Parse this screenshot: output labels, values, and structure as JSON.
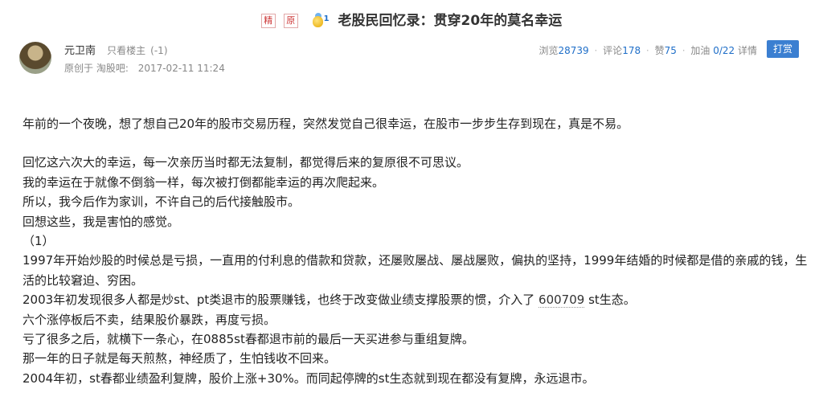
{
  "post": {
    "badge_jing": "精",
    "badge_yuan": "原",
    "level": "1",
    "title": "老股民回忆录：贯穿20年的莫名幸运"
  },
  "author": {
    "name": "元卫南",
    "only_owner": "只看楼主",
    "score": "(-1)",
    "origin": "原创于 淘股吧:",
    "date": "2017-02-11 11:24"
  },
  "stats": {
    "views_label": "浏览",
    "views": "28739",
    "comments_label": "评论",
    "comments": "178",
    "likes_label": "赞",
    "likes": "75",
    "boost_label": "加油",
    "boost": "0/22",
    "detail_label": "详情",
    "tip_label": "打赏"
  },
  "content": {
    "p1": "年前的一个夜晚，想了想自己20年的股市交易历程，突然发觉自己很幸运，在股市一步步生存到现在，真是不易。",
    "p2": "回忆这六次大的幸运，每一次亲历当时都无法复制，都觉得后来的复原很不可思议。",
    "p3": "我的幸运在于就像不倒翁一样，每次被打倒都能幸运的再次爬起来。",
    "p4": "所以，我今后作为家训，不许自己的后代接触股市。",
    "p5": "回想这些，我是害怕的感觉。",
    "p6": "（1）",
    "p7": "1997年开始炒股的时候总是亏损，一直用的付利息的借款和贷款，还屡败屡战、屡战屡败，偏执的坚持，1999年结婚的时候都是借的亲戚的钱，生活的比较窘迫、穷困。",
    "p8a": "2003年初发现很多人都是炒st、pt类退市的股票赚钱，也终于改变做业绩支撑股票的惯，介入了 ",
    "p8_stock": "600709",
    "p8b": " st生态。",
    "p9": "六个涨停板后不卖，结果股价暴跌，再度亏损。",
    "p10": "亏了很多之后，就横下一条心，在0885st春都退市前的最后一天买进参与重组复牌。",
    "p11": "那一年的日子就是每天煎熬，神经质了，生怕钱收不回来。",
    "p12": "2004年初，st春都业绩盈利复牌，股价上涨+30%。而同起停牌的st生态就到现在都没有复牌，永远退市。"
  }
}
